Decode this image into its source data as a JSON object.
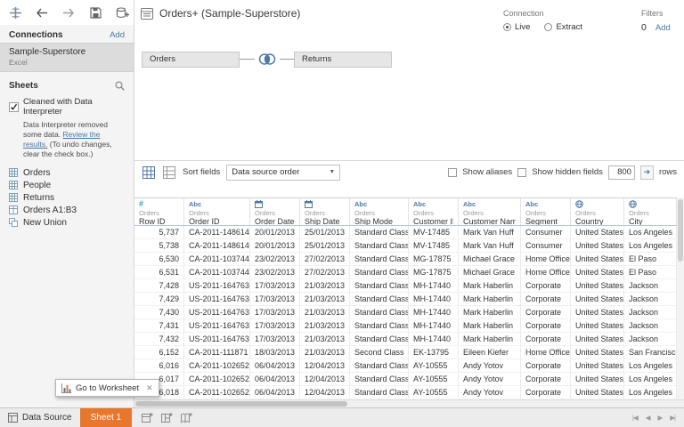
{
  "colors": {
    "accent_orange": "#e8762c",
    "icon_blue": "#4e79a7",
    "link_blue": "#4a78a0",
    "number_teal": "#2fa3a8"
  },
  "icons": {
    "back": "left-arrow",
    "forward": "right-arrow",
    "save": "floppy",
    "add_data": "database-plus",
    "search": "magnifier",
    "join": "venn-circles"
  },
  "sidebar": {
    "connections_label": "Connections",
    "add_link": "Add",
    "connection": {
      "name": "Sample-Superstore",
      "type": "Excel"
    },
    "sheets_label": "Sheets",
    "interpreter_checkbox": "Cleaned with Data Interpreter",
    "note_text_1": "Data Interpreter removed some data. ",
    "note_link": "Review the results.",
    "note_text_2": " (To undo changes, clear the check box.)",
    "sheets": [
      {
        "name": "Orders",
        "icon": "sheet-grid"
      },
      {
        "name": "People",
        "icon": "sheet-grid"
      },
      {
        "name": "Returns",
        "icon": "sheet-grid"
      },
      {
        "name": "Orders A1:B3",
        "icon": "named-range"
      },
      {
        "name": "New Union",
        "icon": "union"
      }
    ]
  },
  "header": {
    "title": "Orders+ (Sample-Superstore)",
    "connection_label": "Connection",
    "live_label": "Live",
    "extract_label": "Extract",
    "filters_label": "Filters",
    "filters_count": "0",
    "filters_add": "Add"
  },
  "canvas": {
    "left_table": "Orders",
    "right_table": "Returns"
  },
  "grid_toolbar": {
    "sort_fields_label": "Sort fields",
    "sort_order_value": "Data source order",
    "show_aliases_label": "Show aliases",
    "show_hidden_label": "Show hidden fields",
    "rows_value": "800",
    "rows_label": "rows"
  },
  "table": {
    "columns": [
      {
        "type": "number",
        "source": "Orders",
        "name": "Row ID"
      },
      {
        "type": "string",
        "source": "Orders",
        "name": "Order ID"
      },
      {
        "type": "date",
        "source": "Orders",
        "name": "Order Date"
      },
      {
        "type": "date",
        "source": "Orders",
        "name": "Ship Date"
      },
      {
        "type": "string",
        "source": "Orders",
        "name": "Ship Mode"
      },
      {
        "type": "string",
        "source": "Orders",
        "name": "Customer ID"
      },
      {
        "type": "string",
        "source": "Orders",
        "name": "Customer Name"
      },
      {
        "type": "string",
        "source": "Orders",
        "name": "Segment"
      },
      {
        "type": "geo",
        "source": "Orders",
        "name": "Country"
      },
      {
        "type": "geo",
        "source": "Orders",
        "name": "City"
      }
    ],
    "rows": [
      [
        "5,737",
        "CA-2011-148614",
        "20/01/2013",
        "25/01/2013",
        "Standard Class",
        "MV-17485",
        "Mark Van Huff",
        "Consumer",
        "United States",
        "Los Angeles"
      ],
      [
        "5,738",
        "CA-2011-148614",
        "20/01/2013",
        "25/01/2013",
        "Standard Class",
        "MV-17485",
        "Mark Van Huff",
        "Consumer",
        "United States",
        "Los Angeles"
      ],
      [
        "6,530",
        "CA-2011-103744",
        "23/02/2013",
        "27/02/2013",
        "Standard Class",
        "MG-17875",
        "Michael Grace",
        "Home Office",
        "United States",
        "El Paso"
      ],
      [
        "6,531",
        "CA-2011-103744",
        "23/02/2013",
        "27/02/2013",
        "Standard Class",
        "MG-17875",
        "Michael Grace",
        "Home Office",
        "United States",
        "El Paso"
      ],
      [
        "7,428",
        "US-2011-164763",
        "17/03/2013",
        "21/03/2013",
        "Standard Class",
        "MH-17440",
        "Mark Haberlin",
        "Corporate",
        "United States",
        "Jackson"
      ],
      [
        "7,429",
        "US-2011-164763",
        "17/03/2013",
        "21/03/2013",
        "Standard Class",
        "MH-17440",
        "Mark Haberlin",
        "Corporate",
        "United States",
        "Jackson"
      ],
      [
        "7,430",
        "US-2011-164763",
        "17/03/2013",
        "21/03/2013",
        "Standard Class",
        "MH-17440",
        "Mark Haberlin",
        "Corporate",
        "United States",
        "Jackson"
      ],
      [
        "7,431",
        "US-2011-164763",
        "17/03/2013",
        "21/03/2013",
        "Standard Class",
        "MH-17440",
        "Mark Haberlin",
        "Corporate",
        "United States",
        "Jackson"
      ],
      [
        "7,432",
        "US-2011-164763",
        "17/03/2013",
        "21/03/2013",
        "Standard Class",
        "MH-17440",
        "Mark Haberlin",
        "Corporate",
        "United States",
        "Jackson"
      ],
      [
        "6,152",
        "CA-2011-111871",
        "18/03/2013",
        "21/03/2013",
        "Second Class",
        "EK-13795",
        "Eileen Kiefer",
        "Home Office",
        "United States",
        "San Francisco"
      ],
      [
        "6,016",
        "CA-2011-102652",
        "06/04/2013",
        "12/04/2013",
        "Standard Class",
        "AY-10555",
        "Andy Yotov",
        "Corporate",
        "United States",
        "Los Angeles"
      ],
      [
        "6,017",
        "CA-2011-102652",
        "06/04/2013",
        "12/04/2013",
        "Standard Class",
        "AY-10555",
        "Andy Yotov",
        "Corporate",
        "United States",
        "Los Angeles"
      ],
      [
        "6,018",
        "CA-2011-102652",
        "06/04/2013",
        "12/04/2013",
        "Standard Class",
        "AY-10555",
        "Andy Yotov",
        "Corporate",
        "United States",
        "Los Angeles"
      ]
    ]
  },
  "tooltip": {
    "label": "Go to Worksheet"
  },
  "statusbar": {
    "datasource_tab": "Data Source",
    "sheet_tab": "Sheet 1"
  }
}
